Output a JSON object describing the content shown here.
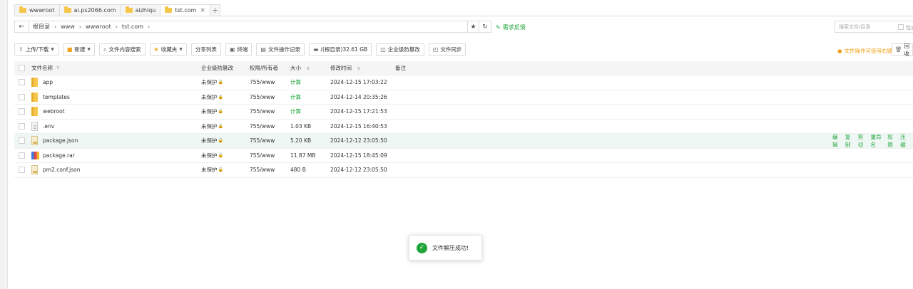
{
  "tabs": [
    {
      "label": "wwwroot",
      "active": false
    },
    {
      "label": "ai.ps2066.com",
      "active": false
    },
    {
      "label": "aizhiqu",
      "active": false
    },
    {
      "label": "tst.com",
      "active": true
    }
  ],
  "tab_close": "×",
  "tab_add": "+",
  "breadcrumbs": [
    "根目录",
    "www",
    "wwwroot",
    "tst.com"
  ],
  "breadcrumb_sep": "›",
  "feedback_label": "需求反馈",
  "search": {
    "placeholder": "搜索文件/目录",
    "checkbox_label": "包含"
  },
  "toolbar": {
    "upload": "上传/下载",
    "new": "新建",
    "content_search": "文件内容搜索",
    "favorites": "收藏夹",
    "share_list": "分享列表",
    "terminal": "终端",
    "op_log": "文件操作记录",
    "disk": "/(根目录)32.61 GB",
    "tamper": "企业级防篡改",
    "sync": "文件同步"
  },
  "warn_label": "文件操作可使用右键",
  "recycle_label": "回收",
  "columns": {
    "name": "文件名称",
    "protect": "企业级防篡改",
    "perm": "权限/所有者",
    "size": "大小",
    "mtime": "修改时间",
    "note": "备注"
  },
  "rows": [
    {
      "name": "app",
      "icon": "folder",
      "protect": "未保护",
      "perm": "755/www",
      "size": "计算",
      "size_link": true,
      "mtime": "2024-12-15 17:03:22"
    },
    {
      "name": "templates",
      "icon": "folder",
      "protect": "未保护",
      "perm": "755/www",
      "size": "计算",
      "size_link": true,
      "mtime": "2024-12-14 20:35:26"
    },
    {
      "name": "webroot",
      "icon": "folder",
      "protect": "未保护",
      "perm": "755/www",
      "size": "计算",
      "size_link": true,
      "mtime": "2024-12-15 17:21:53"
    },
    {
      "name": ".env",
      "icon": "file",
      "protect": "未保护",
      "perm": "755/www",
      "size": "1.03 KB",
      "size_link": false,
      "mtime": "2024-12-15 16:40:53"
    },
    {
      "name": "package.json",
      "icon": "json",
      "protect": "未保护",
      "perm": "755/www",
      "size": "5.20 KB",
      "size_link": false,
      "mtime": "2024-12-12 23:05:50",
      "highlighted": true
    },
    {
      "name": "package.rar",
      "icon": "rar",
      "protect": "未保护",
      "perm": "755/www",
      "size": "11.87 MB",
      "size_link": false,
      "mtime": "2024-12-15 18:45:09"
    },
    {
      "name": "pm2.conf.json",
      "icon": "json",
      "protect": "未保护",
      "perm": "755/www",
      "size": "480 B",
      "size_link": false,
      "mtime": "2024-12-12 23:05:50"
    }
  ],
  "row_actions": [
    "编辑",
    "复制",
    "剪切",
    "重命名",
    "权限",
    "压缩"
  ],
  "toast_message": "文件解压成功!",
  "colors": {
    "accent": "#20a53a",
    "warn": "#f0a31a",
    "folder": "#f5c64a"
  }
}
